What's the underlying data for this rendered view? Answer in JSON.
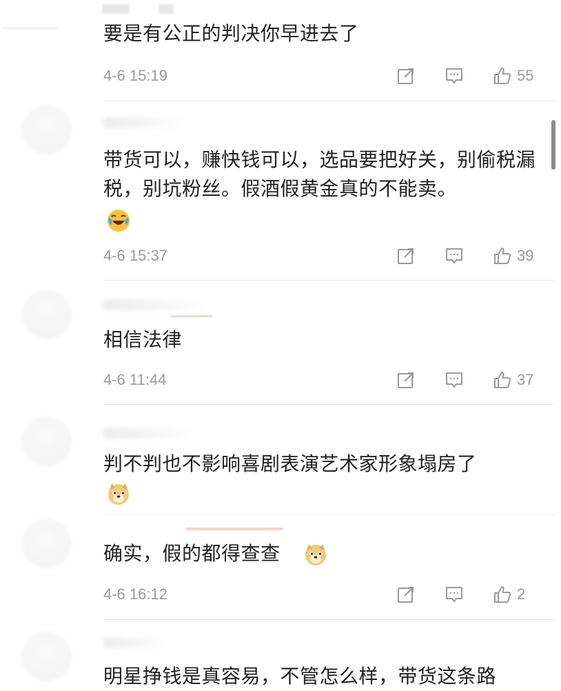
{
  "comments": [
    {
      "text": "要是有公正的判决你早进去了",
      "time": "4-6 15:19",
      "likes": "55"
    },
    {
      "text": "带货可以，赚快钱可以，选品要把好关，别偷税漏税，别坑粉丝。假酒假黄金真的不能卖。",
      "time": "4-6 15:37",
      "likes": "39",
      "emoji": "laugh-cry-emoji"
    },
    {
      "text": "相信法律",
      "time": "4-6 11:44",
      "likes": "37"
    },
    {
      "text": "判不判也不影响喜剧表演艺术家形象塌房了",
      "emoji": "doge-emoji"
    },
    {
      "text": "确实，假的都得查查",
      "time": "4-6 16:12",
      "likes": "2",
      "emoji": "doge-emoji"
    },
    {
      "text": "明星挣钱是真容易，不管怎么样，带货这条路"
    }
  ],
  "icons": {
    "share": "share-icon",
    "comment": "comment-icon",
    "like": "thumbs-up-icon"
  },
  "colors": {
    "meta_gray": "#9a9a9a",
    "divider": "#e9e9e9",
    "text": "#222222",
    "scrollbar": "#8c8c8c"
  }
}
